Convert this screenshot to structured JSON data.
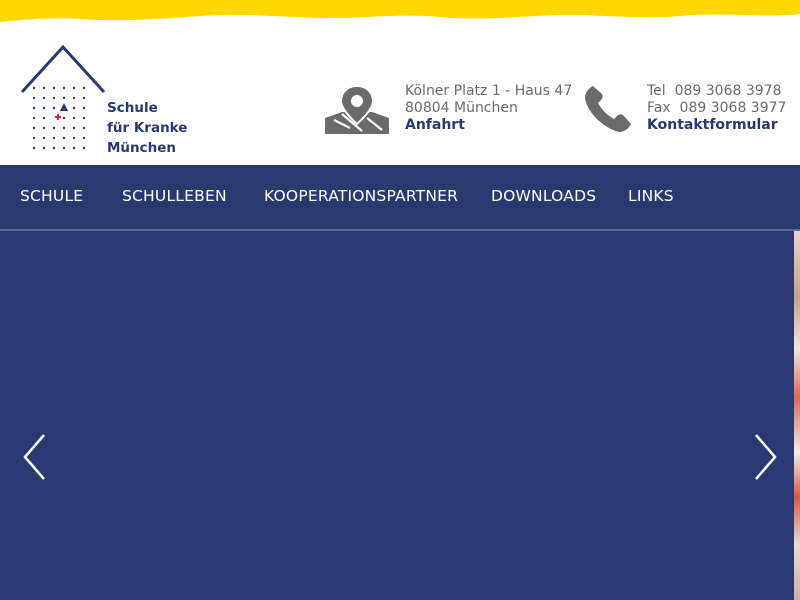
{
  "brand": {
    "line1": "Schule",
    "line2": "für Kranke München",
    "icon": "house-logo-icon",
    "colors": {
      "navy": "#283a6f",
      "yellow": "#ffd800",
      "red": "#e3232b"
    }
  },
  "address": {
    "icon": "map-pin-icon",
    "line1": "Kölner Platz 1 - Haus 47",
    "line2": "80804 München",
    "link": "Anfahrt"
  },
  "contact": {
    "icon": "phone-icon",
    "tel_label": "Tel",
    "tel": "089 3068 3978",
    "fax_label": "Fax",
    "fax": "089 3068 3977",
    "link": "Kontaktformular"
  },
  "nav": {
    "items": [
      "SCHULE",
      "SCHULLEBEN",
      "KOOPERATIONSPARTNER",
      "DOWNLOADS",
      "LINKS"
    ]
  },
  "slider": {
    "prev_icon": "chevron-left-icon",
    "next_icon": "chevron-right-icon"
  }
}
